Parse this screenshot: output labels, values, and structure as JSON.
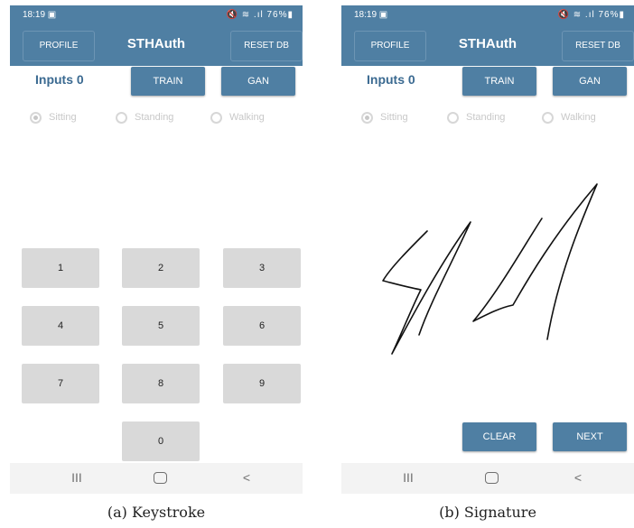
{
  "colors": {
    "accent": "#4f7fa3",
    "key_bg": "#d9d9d9",
    "inputs_text": "#3b6a91",
    "radio_gray": "#c8c8c8"
  },
  "panels": [
    {
      "status": {
        "time": "18:19 ▣",
        "icons": "🔇 ≋ .ıl 76%▮"
      },
      "appbar": {
        "profile": "PROFILE",
        "title": "STHAuth",
        "reset": "RESET DB"
      },
      "inputs_label": "Inputs 0",
      "train": "TRAIN",
      "gan": "GAN",
      "radios": [
        "Sitting",
        "Standing",
        "Walking"
      ],
      "keypad": [
        "1",
        "2",
        "3",
        "4",
        "5",
        "6",
        "7",
        "8",
        "9",
        "0"
      ],
      "navbar": {
        "recent": "III",
        "home": "home-icon",
        "back": "<"
      },
      "caption": "(a) Keystroke"
    },
    {
      "status": {
        "time": "18:19 ▣",
        "icons": "🔇 ≋ .ıl 76%▮"
      },
      "appbar": {
        "profile": "PROFILE",
        "title": "STHAuth",
        "reset": "RESET DB"
      },
      "inputs_label": "Inputs 0",
      "train": "TRAIN",
      "gan": "GAN",
      "radios": [
        "Sitting",
        "Standing",
        "Walking"
      ],
      "clear": "CLEAR",
      "next": "NEXT",
      "navbar": {
        "recent": "III",
        "home": "home-icon",
        "back": "<"
      },
      "caption": "(b) Signature"
    }
  ]
}
